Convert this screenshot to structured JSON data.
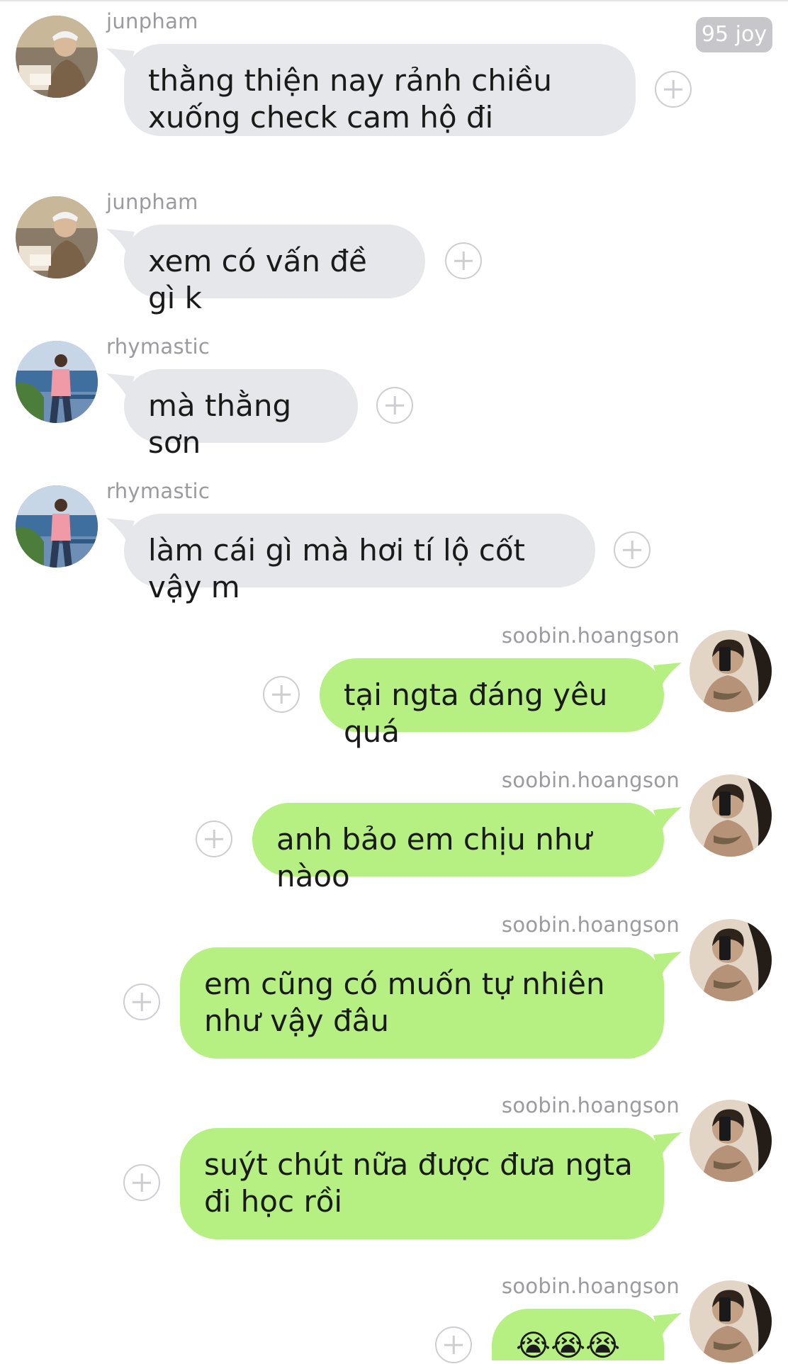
{
  "header": {
    "badge_label": "95 joy"
  },
  "messages": [
    {
      "user": "junpham",
      "text": "thằng thiện nay rảnh chiều xuống check cam hộ đi",
      "avatar": "junpham-avatar"
    },
    {
      "user": "junpham",
      "text": "xem có vấn đề gì k",
      "avatar": "junpham-avatar"
    },
    {
      "user": "rhymastic",
      "text": "mà thằng sơn",
      "avatar": "rhymastic-avatar"
    },
    {
      "user": "rhymastic",
      "text": "làm cái gì mà hơi tí lộ cốt vậy m",
      "avatar": "rhymastic-avatar"
    },
    {
      "user": "soobin.hoangson",
      "text": "tại ngta đáng yêu quá",
      "avatar": "soobin-avatar"
    },
    {
      "user": "soobin.hoangson",
      "text": "anh bảo em chịu như nàoo",
      "avatar": "soobin-avatar"
    },
    {
      "user": "soobin.hoangson",
      "text": "em cũng có muốn tự nhiên như vậy đâu",
      "avatar": "soobin-avatar"
    },
    {
      "user": "soobin.hoangson",
      "text": "suýt chút nữa được đưa ngta đi học rồi",
      "avatar": "soobin-avatar"
    },
    {
      "user": "soobin.hoangson",
      "text": "😭😭😭",
      "avatar": "soobin-avatar"
    }
  ],
  "colors": {
    "incoming_bubble": "#e6e7eb",
    "outgoing_bubble": "#b7f082",
    "username": "#9a9a9f",
    "badge_bg": "#c7c7cb"
  },
  "icons": {
    "react": "plus-circle-icon"
  }
}
